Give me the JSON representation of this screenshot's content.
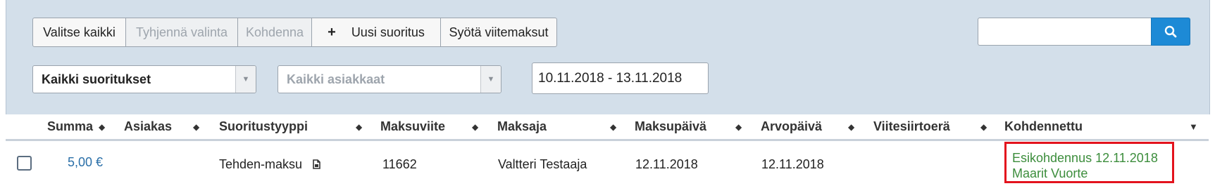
{
  "toolbar": {
    "select_all": "Valitse kaikki",
    "clear_selection": "Tyhjennä valinta",
    "allocate": "Kohdenna",
    "new_payment": "Uusi suoritus",
    "enter_reference_payments": "Syötä viitemaksut"
  },
  "search": {
    "value": "",
    "placeholder": ""
  },
  "filters": {
    "payment_types": "Kaikki suoritukset",
    "customers": "Kaikki asiakkaat",
    "date_range": "10.11.2018 - 13.11.2018"
  },
  "table": {
    "columns": {
      "amount": "Summa",
      "customer": "Asiakas",
      "payment_type": "Suoritustyyppi",
      "reference": "Maksuviite",
      "payer": "Maksaja",
      "payment_date": "Maksupäivä",
      "value_date": "Arvopäivä",
      "reference_batch": "Viitesiirtoerä",
      "allocated": "Kohdennettu"
    },
    "rows": [
      {
        "checked": false,
        "amount": "5,00 €",
        "customer": "",
        "payment_type": "Tehden-maksu",
        "reference": "11662",
        "payer": "Valtteri Testaaja",
        "payment_date": "12.11.2018",
        "value_date": "12.11.2018",
        "reference_batch": "",
        "allocated_line1": "Esikohdennus 12.11.2018",
        "allocated_line2": "Maarit Vuorte"
      }
    ]
  },
  "icons": {
    "search": "search-icon",
    "plus": "plus-icon",
    "document": "document-icon",
    "dropdown": "chevron-down-icon",
    "sort": "sort-icon"
  },
  "colors": {
    "panel": "#d3dfea",
    "search_button": "#1d8ad6",
    "link": "#2a6fa8",
    "allocated_text": "#3c8d3c",
    "highlight_border": "#e3131d"
  }
}
